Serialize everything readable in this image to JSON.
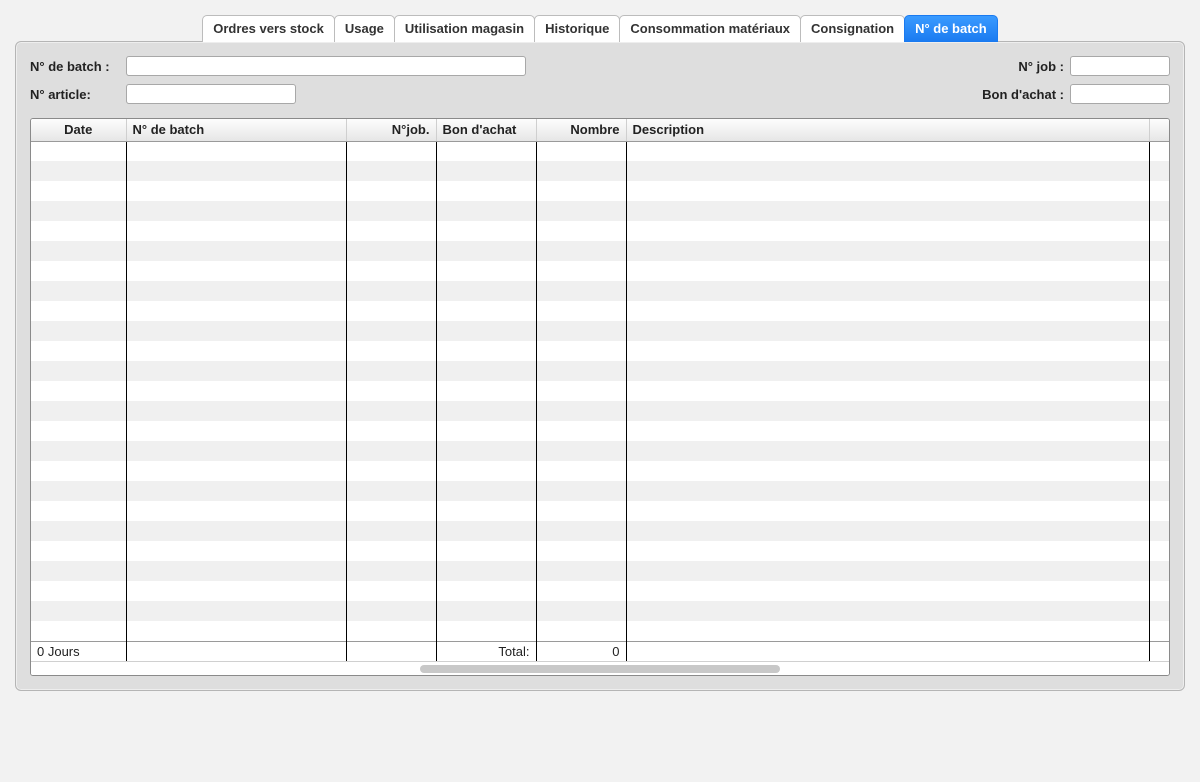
{
  "tabs": [
    {
      "label": "Ordres vers stock",
      "active": false
    },
    {
      "label": "Usage",
      "active": false
    },
    {
      "label": "Utilisation magasin",
      "active": false
    },
    {
      "label": "Historique",
      "active": false
    },
    {
      "label": "Consommation matériaux",
      "active": false
    },
    {
      "label": "Consignation",
      "active": false
    },
    {
      "label": "N° de batch",
      "active": true
    }
  ],
  "filters": {
    "batch_label": "N° de batch :",
    "batch_value": "",
    "article_label": "N° article:",
    "article_value": "",
    "job_label": "N° job :",
    "job_value": "",
    "bon_label": "Bon d'achat :",
    "bon_value": ""
  },
  "table": {
    "headers": {
      "date": "Date",
      "batch": "N° de batch",
      "job": "N°job.",
      "bon": "Bon d'achat",
      "nombre": "Nombre",
      "description": "Description"
    },
    "rows": [],
    "empty_row_count": 25,
    "footer": {
      "days_text": "0 Jours",
      "total_label": "Total:",
      "total_value": "0"
    }
  }
}
